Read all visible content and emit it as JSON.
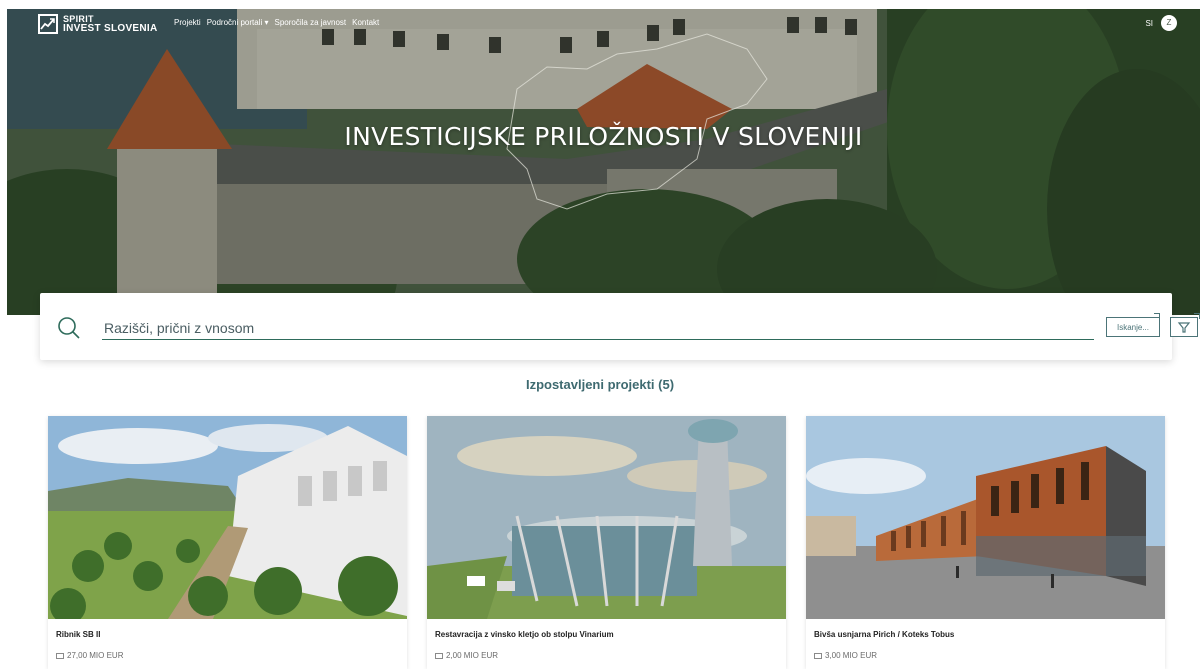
{
  "header": {
    "logo_line1": "SPIRIT",
    "logo_line2": "INVEST SLOVENIA",
    "nav": [
      "Projekti",
      "Področni portali ▾",
      "Sporočila za javnost",
      "Kontakt"
    ],
    "language": "SI",
    "user_initial": "Z"
  },
  "hero": {
    "title": "INVESTICIJSKE PRILOŽNOSTI V SLOVENIJI"
  },
  "search": {
    "placeholder": "Razišči, prični z vnosom",
    "button_label": "Iskanje...",
    "icons": [
      "search-icon",
      "filter-icon"
    ]
  },
  "featured": {
    "title": "Izpostavljeni projekti (5)",
    "projects": [
      {
        "name": "Ribnik SB II",
        "price": "27,00 MIO EUR"
      },
      {
        "name": "Restavracija z vinsko kletjo ob stolpu Vinarium",
        "price": "2,00 MIO EUR"
      },
      {
        "name": "Bivša usnjarna Pirich / Koteks Tobus",
        "price": "3,00 MIO EUR"
      }
    ]
  },
  "colors": {
    "accent": "#3e6a70",
    "search_line": "#2e6b5b",
    "hero_green": "#4f6548"
  }
}
